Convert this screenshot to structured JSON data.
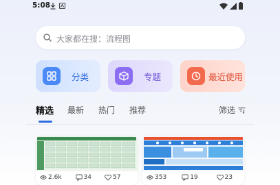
{
  "status_bar": {
    "time": "5:08"
  },
  "search": {
    "placeholder": "大家都在搜：流程图"
  },
  "categories": [
    {
      "label": "分类",
      "icon": "grid-icon",
      "color": "#4b89f5"
    },
    {
      "label": "专题",
      "icon": "cube-icon",
      "color": "#8c6ef3"
    },
    {
      "label": "最近使用",
      "icon": "clock-icon",
      "color": "#f26a4e"
    }
  ],
  "tabs": [
    {
      "label": "精选",
      "active": true
    },
    {
      "label": "最新"
    },
    {
      "label": "热门"
    },
    {
      "label": "推荐"
    }
  ],
  "filter": {
    "label": "筛选"
  },
  "templates": [
    {
      "views": "2.6k",
      "comments": "34",
      "likes": "57"
    },
    {
      "views": "353",
      "comments": "19",
      "likes": "23"
    }
  ],
  "colors": {
    "accent": "#2f6be0"
  }
}
